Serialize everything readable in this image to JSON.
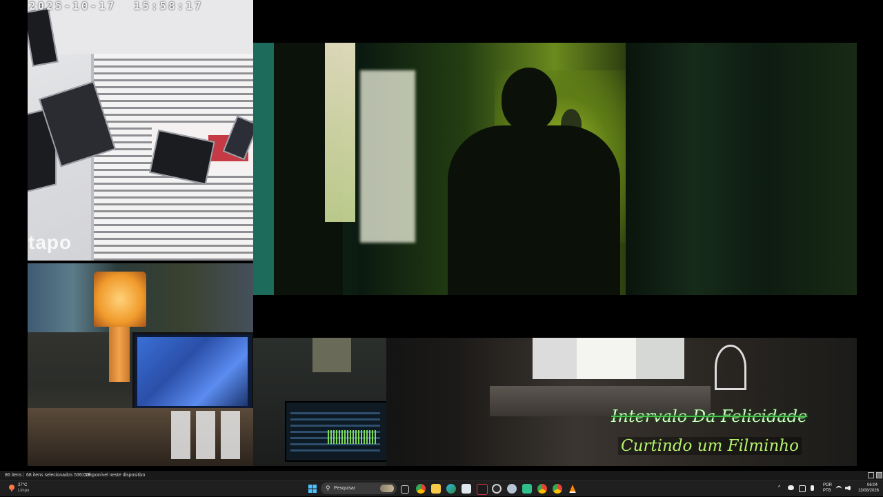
{
  "camera_top": {
    "timestamp": "2025-10-17  15:58:17",
    "brand": "tapo"
  },
  "stream_overlay": {
    "title": "Intervalo Da Felicidade",
    "subtitle": "Curtindo um Filminho"
  },
  "explorer_status": {
    "items_count": "86 itens",
    "selected": "68 itens selecionados  536 GB",
    "availability": "Disponível neste dispositivo",
    "divider": "|"
  },
  "taskbar": {
    "weather": {
      "temp": "27°C",
      "condition": "Limpo",
      "icon": "weather-icon"
    },
    "search": {
      "label": "Pesquisar",
      "icon": "search-icon"
    },
    "apps": [
      {
        "name": "windows-start-icon",
        "color": "#4cc2ff"
      },
      {
        "name": "task-view-icon",
        "color": "#d0d0d0"
      },
      {
        "name": "chrome-icon",
        "color": "#f4b400"
      },
      {
        "name": "file-explorer-icon",
        "color": "#f7c948"
      },
      {
        "name": "edge-icon",
        "color": "#2fb6e6"
      },
      {
        "name": "notepad-icon",
        "color": "#dfe6ee"
      },
      {
        "name": "capcut-icon",
        "color": "#e0334a"
      },
      {
        "name": "obs-icon",
        "color": "#cfcfcf"
      },
      {
        "name": "steam-icon",
        "color": "#b7c4d4"
      },
      {
        "name": "app-green-icon",
        "color": "#2fbf8c"
      },
      {
        "name": "chrome-profile-icon",
        "color": "#ea4335"
      },
      {
        "name": "chrome-alt-icon",
        "color": "#34a853"
      },
      {
        "name": "vlc-icon",
        "color": "#ff8800"
      }
    ],
    "tray": {
      "chevron": "^",
      "lang_line1": "POR",
      "lang_line2": "PTB",
      "time": "06:04",
      "date": "13/08/2026"
    }
  }
}
